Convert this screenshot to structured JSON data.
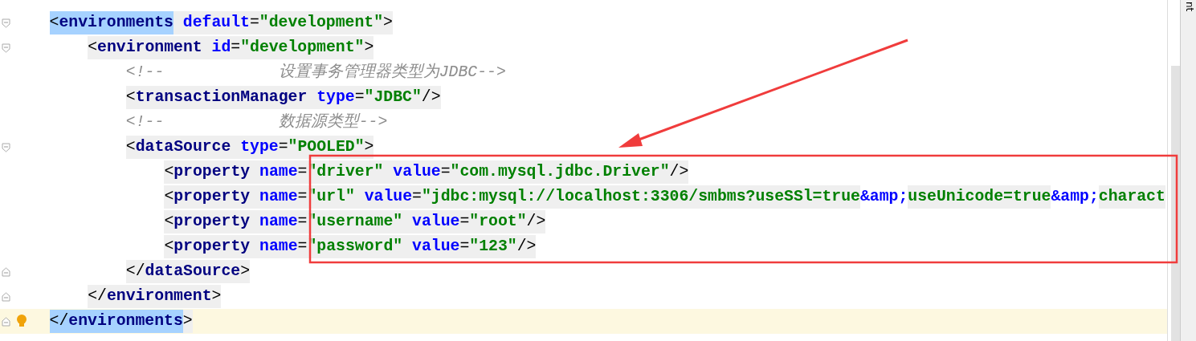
{
  "editor": {
    "lines": [
      {
        "fold_start": true,
        "fold_end": false,
        "current": false,
        "matched": true,
        "tokens": [
          {
            "kind": "punct",
            "text": "<"
          },
          {
            "kind": "tag",
            "text": "environments"
          },
          {
            "kind": "attr",
            "text": " default"
          },
          {
            "kind": "punct",
            "text": "="
          },
          {
            "kind": "value",
            "text": "\"development\""
          },
          {
            "kind": "punct",
            "text": ">"
          }
        ],
        "children": [
          {
            "fold_start": true,
            "fold_end": false,
            "current": false,
            "matched": false,
            "tokens": [
              {
                "kind": "punct",
                "text": "<"
              },
              {
                "kind": "tag",
                "text": "environment"
              },
              {
                "kind": "attr",
                "text": " id"
              },
              {
                "kind": "punct",
                "text": "="
              },
              {
                "kind": "value",
                "text": "\"development\""
              },
              {
                "kind": "punct",
                "text": ">"
              }
            ],
            "children": [
              {
                "fold_start": false,
                "fold_end": false,
                "current": false,
                "matched": false,
                "tokens": [
                  {
                    "kind": "comment",
                    "text": "<!--            设置事务管理器类型为JDBC-->"
                  }
                ]
              },
              {
                "fold_start": false,
                "fold_end": false,
                "current": false,
                "matched": false,
                "tokens": [
                  {
                    "kind": "punct",
                    "text": "<"
                  },
                  {
                    "kind": "tag",
                    "text": "transactionManager"
                  },
                  {
                    "kind": "attr",
                    "text": " type"
                  },
                  {
                    "kind": "punct",
                    "text": "="
                  },
                  {
                    "kind": "value",
                    "text": "\"JDBC\""
                  },
                  {
                    "kind": "punct",
                    "text": "/>"
                  }
                ]
              },
              {
                "fold_start": false,
                "fold_end": false,
                "current": false,
                "matched": false,
                "tokens": [
                  {
                    "kind": "comment",
                    "text": "<!--            数据源类型-->"
                  }
                ]
              },
              {
                "fold_start": true,
                "fold_end": false,
                "current": false,
                "matched": false,
                "tokens": [
                  {
                    "kind": "punct",
                    "text": "<"
                  },
                  {
                    "kind": "tag",
                    "text": "dataSource"
                  },
                  {
                    "kind": "attr",
                    "text": " type"
                  },
                  {
                    "kind": "punct",
                    "text": "="
                  },
                  {
                    "kind": "value",
                    "text": "\"POOLED\""
                  },
                  {
                    "kind": "punct",
                    "text": ">"
                  }
                ],
                "children": [
                  {
                    "fold_start": false,
                    "fold_end": false,
                    "current": false,
                    "matched": false,
                    "tokens": [
                      {
                        "kind": "punct",
                        "text": "<"
                      },
                      {
                        "kind": "tag",
                        "text": "property"
                      },
                      {
                        "kind": "attr",
                        "text": " name"
                      },
                      {
                        "kind": "punct",
                        "text": "="
                      },
                      {
                        "kind": "value",
                        "text": "\"driver\""
                      },
                      {
                        "kind": "attr",
                        "text": " value"
                      },
                      {
                        "kind": "punct",
                        "text": "="
                      },
                      {
                        "kind": "value",
                        "text": "\"com.mysql.jdbc.Driver\""
                      },
                      {
                        "kind": "punct",
                        "text": "/>"
                      }
                    ]
                  },
                  {
                    "fold_start": false,
                    "fold_end": false,
                    "current": false,
                    "matched": false,
                    "tokens": [
                      {
                        "kind": "punct",
                        "text": "<"
                      },
                      {
                        "kind": "tag",
                        "text": "property"
                      },
                      {
                        "kind": "attr",
                        "text": " name"
                      },
                      {
                        "kind": "punct",
                        "text": "="
                      },
                      {
                        "kind": "value",
                        "text": "\"url\""
                      },
                      {
                        "kind": "attr",
                        "text": " value"
                      },
                      {
                        "kind": "punct",
                        "text": "="
                      },
                      {
                        "kind": "value",
                        "text": "\"jdbc:mysql://localhost:3306/smbms?useSSl=true"
                      },
                      {
                        "kind": "entity",
                        "text": "&amp;"
                      },
                      {
                        "kind": "value",
                        "text": "useUnicode=true"
                      },
                      {
                        "kind": "entity",
                        "text": "&amp;"
                      },
                      {
                        "kind": "value",
                        "text": "charact"
                      }
                    ]
                  },
                  {
                    "fold_start": false,
                    "fold_end": false,
                    "current": false,
                    "matched": false,
                    "tokens": [
                      {
                        "kind": "punct",
                        "text": "<"
                      },
                      {
                        "kind": "tag",
                        "text": "property"
                      },
                      {
                        "kind": "attr",
                        "text": " name"
                      },
                      {
                        "kind": "punct",
                        "text": "="
                      },
                      {
                        "kind": "value",
                        "text": "\"username\""
                      },
                      {
                        "kind": "attr",
                        "text": " value"
                      },
                      {
                        "kind": "punct",
                        "text": "="
                      },
                      {
                        "kind": "value",
                        "text": "\"root\""
                      },
                      {
                        "kind": "punct",
                        "text": "/>"
                      }
                    ]
                  },
                  {
                    "fold_start": false,
                    "fold_end": false,
                    "current": false,
                    "matched": false,
                    "tokens": [
                      {
                        "kind": "punct",
                        "text": "<"
                      },
                      {
                        "kind": "tag",
                        "text": "property"
                      },
                      {
                        "kind": "attr",
                        "text": " name"
                      },
                      {
                        "kind": "punct",
                        "text": "="
                      },
                      {
                        "kind": "value",
                        "text": "\"password\""
                      },
                      {
                        "kind": "attr",
                        "text": " value"
                      },
                      {
                        "kind": "punct",
                        "text": "="
                      },
                      {
                        "kind": "value",
                        "text": "\"123\""
                      },
                      {
                        "kind": "punct",
                        "text": "/>"
                      }
                    ]
                  }
                ]
              },
              {
                "fold_start": false,
                "fold_end": true,
                "current": false,
                "matched": false,
                "tokens": [
                  {
                    "kind": "punct",
                    "text": "</"
                  },
                  {
                    "kind": "tag",
                    "text": "dataSource"
                  },
                  {
                    "kind": "punct",
                    "text": ">"
                  }
                ]
              }
            ]
          },
          {
            "fold_start": false,
            "fold_end": true,
            "current": false,
            "matched": false,
            "tokens": [
              {
                "kind": "punct",
                "text": "</"
              },
              {
                "kind": "tag",
                "text": "environment"
              },
              {
                "kind": "punct",
                "text": ">"
              }
            ]
          }
        ]
      },
      {
        "fold_start": false,
        "fold_end": true,
        "current": true,
        "matched": true,
        "tokens": [
          {
            "kind": "punct",
            "text": "</"
          },
          {
            "kind": "tag",
            "text": "environments"
          },
          {
            "kind": "punct",
            "text": ">"
          }
        ]
      }
    ]
  },
  "side_tab": "nt"
}
